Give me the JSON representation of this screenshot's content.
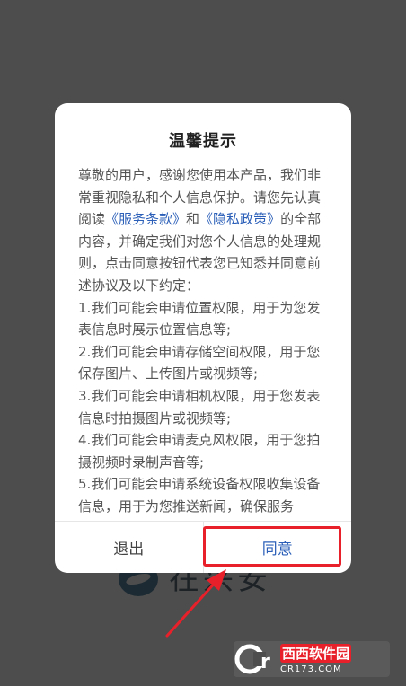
{
  "background": {
    "app_name": "在兴安"
  },
  "dialog": {
    "title": "温馨提示",
    "intro_part1": "尊敬的用户，感谢您使用本产品，我们非常重视隐私和个人信息保护。请您先认真阅读",
    "terms_link": "《服务条款》",
    "and_text": "和",
    "privacy_link": "《隐私政策》",
    "intro_part2": "的全部内容，并确定我们对您个人信息的处理规则，点击同意按钮代表您已知悉并同意前述协议及以下约定：",
    "items": [
      "1.我们可能会申请位置权限，用于为您发表信息时展示位置信息等;",
      "2.我们可能会申请存储空间权限，用于您保存图片、上传图片或视频等;",
      "3.我们可能会申请相机权限，用于您发表信息时拍摄图片或视频等;",
      "4.我们可能会申请麦克风权限，用于您拍摄视频时录制声音等;",
      "5.我们可能会申请系统设备权限收集设备信息，用于为您推送新闻，确保服务"
    ],
    "cancel_label": "退出",
    "agree_label": "同意"
  },
  "watermark": {
    "text_cn": "西西软件园",
    "text_en": "CR173.COM"
  },
  "colors": {
    "link": "#2b5fb8",
    "highlight": "#e8202a",
    "overlay": "#4d4d4d"
  }
}
